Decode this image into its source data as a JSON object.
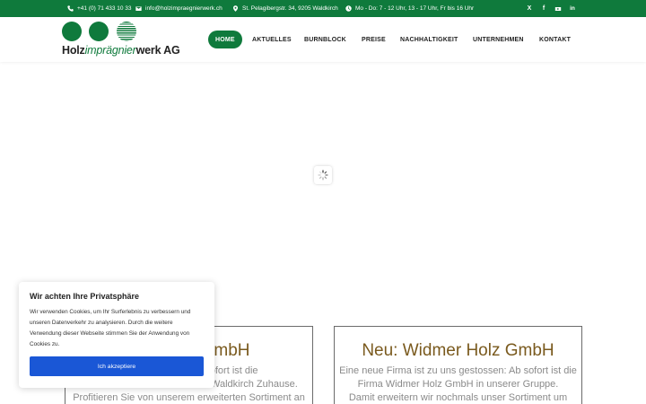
{
  "topbar": {
    "phone": "+41 (0) 71 433 10 33",
    "email": "info@holzimpraegnierwerk.ch",
    "address": "St. Pelagibergstr. 34, 9205 Waldkirch",
    "hours": "Mo - Do: 7 - 12 Uhr, 13 - 17 Uhr, Fr bis 16 Uhr",
    "social": {
      "x": "X",
      "facebook": "f",
      "linkedin": "in"
    }
  },
  "logo": {
    "part1": "Holz",
    "part2": "imprägnier",
    "part3": "werk AG"
  },
  "nav": [
    "HOME",
    "AKTUELLES",
    "BURNBLOCK",
    "PREISE",
    "NACHHALTIGKEIT",
    "UNTERNEHMEN",
    "KONTAKT"
  ],
  "cards": [
    {
      "title": "hle GmbH",
      "lines": [
        "ssen: Ab sofort ist die",
        "Firma Holz + Planie GmbH in Waldkirch Zuhause.",
        "Profitieren Sie von unserem erweiterten Sortiment an"
      ]
    },
    {
      "title": "Neu: Widmer Holz GmbH",
      "lines": [
        "Eine neue Firma ist zu uns gestossen: Ab sofort ist die",
        "Firma Widmer Holz GmbH in unserer Gruppe.",
        "Damit erweitern wir nochmals unser Sortiment um"
      ]
    }
  ],
  "cookie": {
    "title": "Wir achten Ihre Privatsphäre",
    "text": "Wir verwenden Cookies, um Ihr Surferlebnis zu verbessern und unseren Datenverkehr zu analysieren. Durch die weitere Verwendung dieser Webseite stimmen Sie der Anwendung von Cookies zu.",
    "button": "Ich akzeptiere"
  },
  "colors": {
    "brand": "#0f7a3c",
    "button": "#1a57d6",
    "title": "#7a5a1e"
  }
}
